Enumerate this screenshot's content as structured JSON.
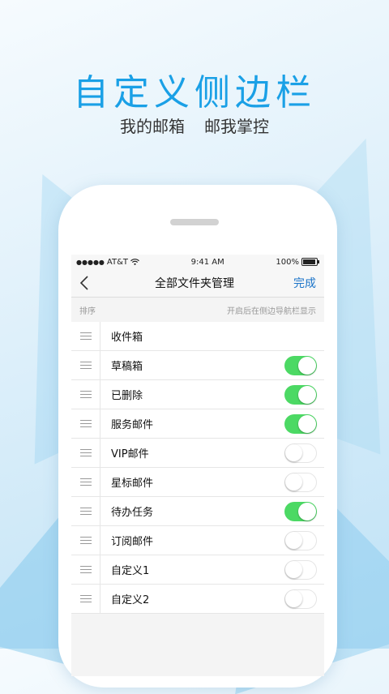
{
  "promo": {
    "headline": "自定义侧边栏",
    "sub1": "我的邮箱",
    "sub2": "邮我掌控"
  },
  "statusbar": {
    "carrier": "AT&T",
    "time": "9:41 AM",
    "battery": "100%"
  },
  "navbar": {
    "title": "全部文件夹管理",
    "done": "完成"
  },
  "section": {
    "left": "排序",
    "right": "开启后在侧边导航栏显示"
  },
  "folders": [
    {
      "label": "收件箱",
      "toggle": null
    },
    {
      "label": "草稿箱",
      "toggle": true
    },
    {
      "label": "已删除",
      "toggle": true
    },
    {
      "label": "服务邮件",
      "toggle": true
    },
    {
      "label": "VIP邮件",
      "toggle": false
    },
    {
      "label": "星标邮件",
      "toggle": false
    },
    {
      "label": "待办任务",
      "toggle": true
    },
    {
      "label": "订阅邮件",
      "toggle": false
    },
    {
      "label": "自定义1",
      "toggle": false
    },
    {
      "label": "自定义2",
      "toggle": false
    }
  ],
  "colors": {
    "headline": "#1aa0e6",
    "toggle_on": "#4cd964",
    "accent": "#1a73c8"
  },
  "icons": [
    "back-chevron-icon",
    "wifi-icon",
    "battery-icon",
    "drag-handle-icon"
  ]
}
